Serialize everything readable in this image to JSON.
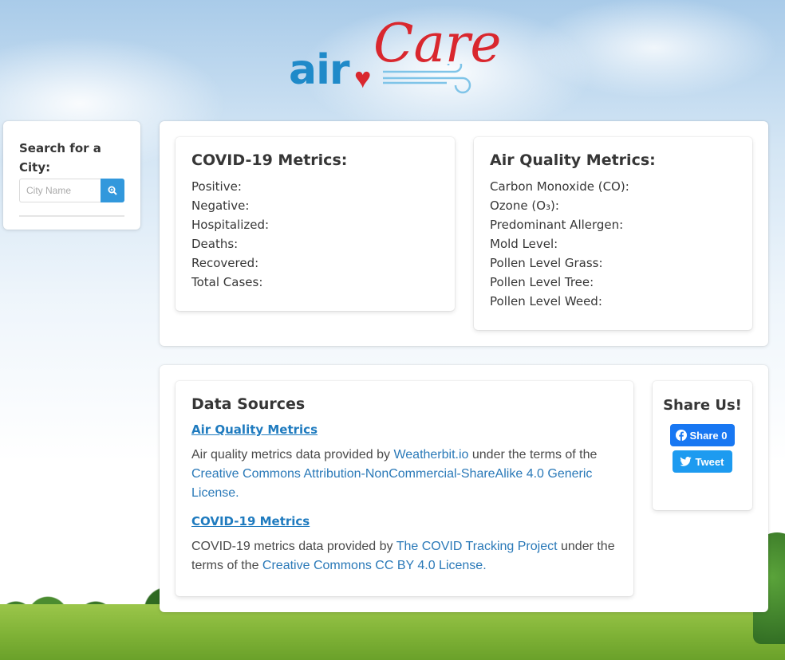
{
  "logo": {
    "air": "air",
    "care": "Care"
  },
  "search": {
    "title": "Search for a City:",
    "placeholder": "City Name"
  },
  "covid": {
    "title": "COVID-19 Metrics:",
    "metrics": [
      "Positive:",
      "Negative:",
      "Hospitalized:",
      "Deaths:",
      "Recovered:",
      "Total Cases:"
    ]
  },
  "air_quality": {
    "title": "Air Quality Metrics:",
    "metrics": [
      "Carbon Monoxide (CO):",
      "Ozone (O₃):",
      "Predominant Allergen:",
      "Mold Level:",
      "Pollen Level Grass:",
      "Pollen Level Tree:",
      "Pollen Level Weed:"
    ]
  },
  "sources": {
    "title": "Data Sources",
    "aq": {
      "heading": "Air Quality Metrics",
      "text_before": "Air quality metrics data provided by ",
      "provider": "Weatherbit.io",
      "text_middle": " under the terms of the ",
      "license": "Creative Commons Attribution-NonCommercial-ShareAlike 4.0 Generic License."
    },
    "covid": {
      "heading": "COVID-19 Metrics",
      "text_before": "COVID-19 metrics data provided by ",
      "provider": "The COVID Tracking Project",
      "text_middle": " under the terms of the ",
      "license": "Creative Commons CC BY 4.0 License."
    }
  },
  "share": {
    "title": "Share Us!",
    "facebook_label": "Share 0",
    "twitter_label": "Tweet"
  },
  "colors": {
    "accent_blue": "#3298dc",
    "logo_red": "#d9272e",
    "logo_blue": "#1f8ac9",
    "facebook": "#1877f2",
    "twitter": "#1d9bf0"
  }
}
